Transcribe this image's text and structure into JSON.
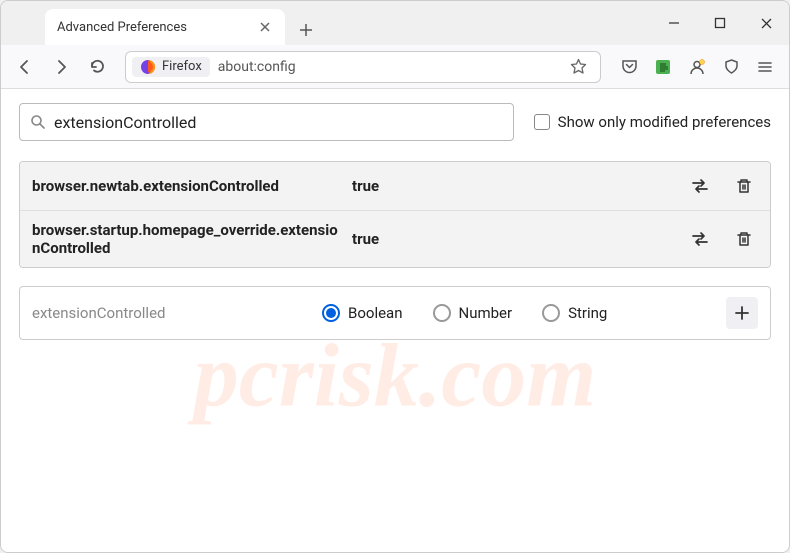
{
  "window": {
    "tab_title": "Advanced Preferences"
  },
  "toolbar": {
    "firefox_label": "Firefox",
    "url": "about:config"
  },
  "search": {
    "value": "extensionControlled",
    "show_modified_label": "Show only modified preferences"
  },
  "preferences": [
    {
      "name": "browser.newtab.extensionControlled",
      "value": "true"
    },
    {
      "name": "browser.startup.homepage_override.extensionControlled",
      "value": "true"
    }
  ],
  "new_pref": {
    "name": "extensionControlled",
    "types": [
      "Boolean",
      "Number",
      "String"
    ],
    "selected": "Boolean"
  },
  "watermark": "pcrisk.com"
}
